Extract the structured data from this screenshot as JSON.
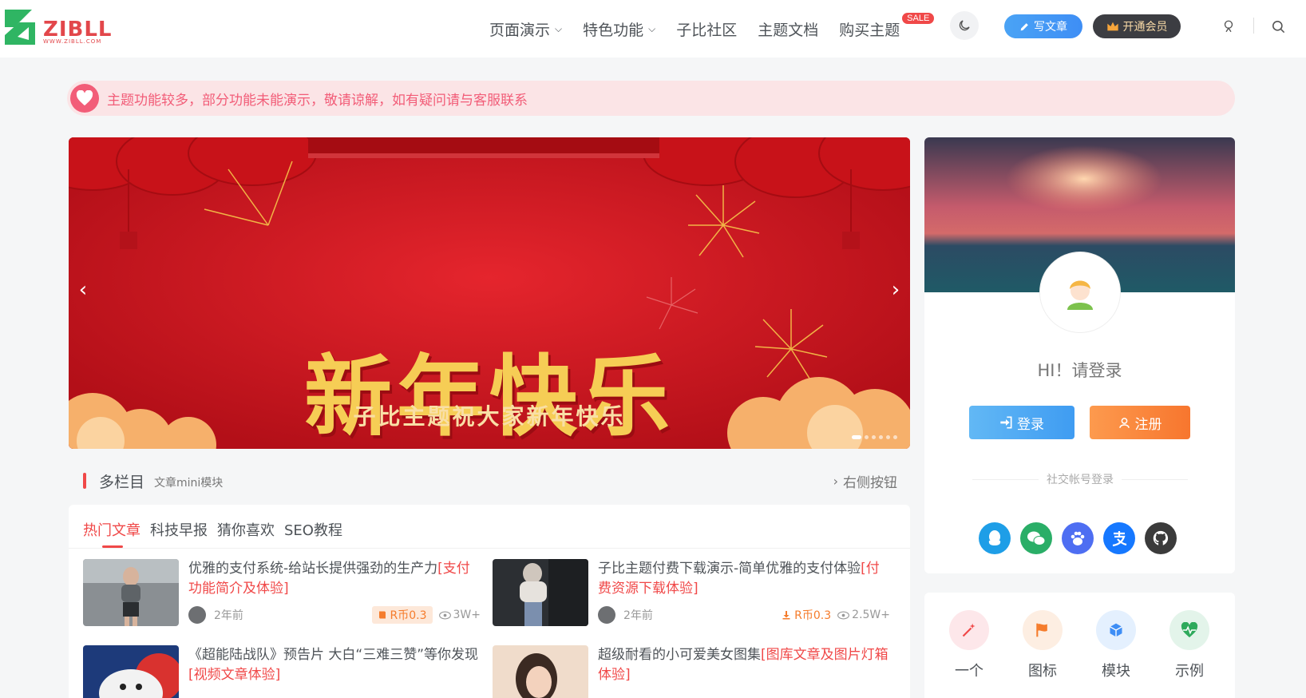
{
  "header": {
    "logo_text": "ZIBLL",
    "logo_sub": "WWW.ZIBLL.COM",
    "nav": [
      {
        "label": "页面演示",
        "has_caret": true
      },
      {
        "label": "特色功能",
        "has_caret": true
      },
      {
        "label": "子比社区",
        "has_caret": false
      },
      {
        "label": "主题文档",
        "has_caret": false
      },
      {
        "label": "购买主题",
        "has_caret": false
      }
    ],
    "sale_badge": "SALE",
    "write_label": "写文章",
    "vip_label": "开通会员"
  },
  "notice": {
    "text": "主题功能较多，部分功能未能演示，敬请谅解，如有疑问请与客服联系"
  },
  "banner": {
    "title": "新年快乐",
    "subtitle": "子比主题祝大家新年快乐"
  },
  "section": {
    "title": "多栏目",
    "subtitle": "文章mini模块",
    "right_label": "右侧按钮"
  },
  "tabs": [
    "热门文章",
    "科技早报",
    "猜你喜欢",
    "SEO教程"
  ],
  "posts": [
    {
      "title": "优雅的支付系统-给站长提供强劲的生产力",
      "tag": "[支付功能简介及体验]",
      "time": "2年前",
      "price": "R币0.3",
      "views": "3W+"
    },
    {
      "title": "子比主题付费下载演示-简单优雅的支付体验",
      "tag": "[付费资源下载体验]",
      "time": "2年前",
      "price": "R币0.3",
      "views": "2.5W+"
    },
    {
      "title": "《超能陆战队》预告片 大白“三难三赞”等你发现",
      "tag": "[视频文章体验]"
    },
    {
      "title": "超级耐看的小可爱美女图集",
      "tag": "[图库文章及图片灯箱体验]"
    }
  ],
  "user_card": {
    "greeting": "HI！请登录",
    "login_label": "登录",
    "register_label": "注册",
    "social_label": "社交帐号登录",
    "socials": [
      "qq-icon",
      "wechat-icon",
      "baidu-icon",
      "alipay-icon",
      "github-icon"
    ]
  },
  "icon_card": {
    "items": [
      {
        "label": "一个",
        "icon": "magic-wand-icon",
        "color": "#f04848"
      },
      {
        "label": "图标",
        "icon": "flag-icon",
        "color": "#f57c2c"
      },
      {
        "label": "模块",
        "icon": "cube-icon",
        "color": "#3e8ef5"
      },
      {
        "label": "示例",
        "icon": "heart-pulse-icon",
        "color": "#2eaa5c"
      }
    ]
  },
  "colors": {
    "accent": "#f04848",
    "blue": "#3e8ef5",
    "orange": "#f7762e"
  }
}
